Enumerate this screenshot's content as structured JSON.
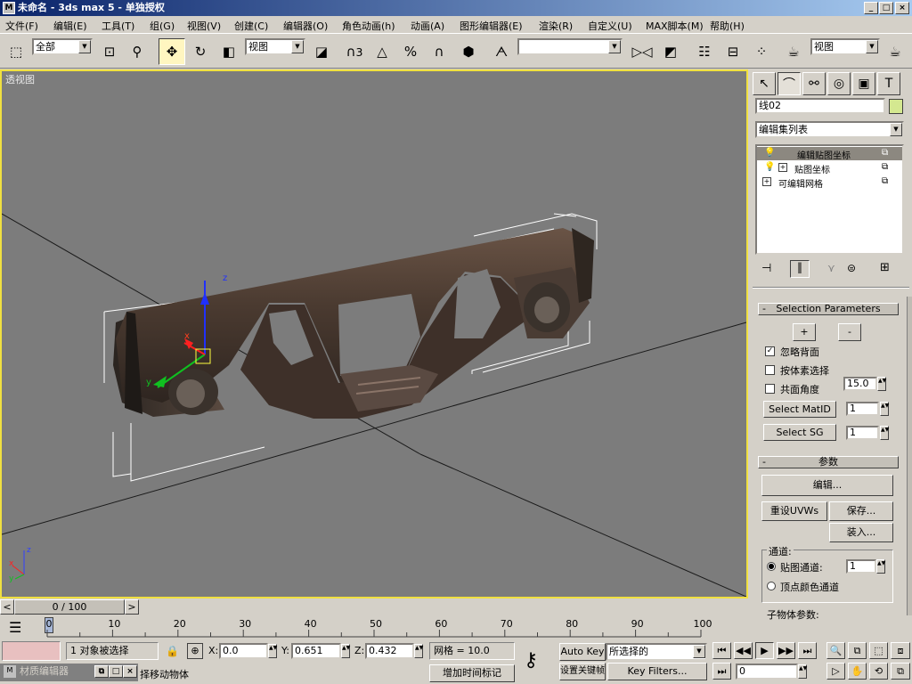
{
  "window": {
    "title": "未命名 - 3ds max 5 - 单独授权",
    "minimize": "_",
    "maximize": "□",
    "close": "×"
  },
  "menu": [
    "文件(F)",
    "编辑(E)",
    "工具(T)",
    "组(G)",
    "视图(V)",
    "创建(C)",
    "编辑器(O)",
    "角色动画(h)",
    "动画(A)",
    "图形编辑器(E)",
    "渲染(R)",
    "自定义(U)",
    "MAX脚本(M)",
    "帮助(H)"
  ],
  "toolbar": {
    "selection_filter": "全部",
    "ref_coord": "视图",
    "named_selection": "",
    "render_type": "视图",
    "snap_label": "3",
    "percent_snap": "%"
  },
  "viewport": {
    "label": "透视图",
    "gizmo_x": "x",
    "gizmo_y": "y",
    "gizmo_z": "z",
    "corner_x": "x",
    "corner_y": "y",
    "corner_z": "z"
  },
  "command_panel": {
    "object_name": "线02",
    "object_color": "#d4e890",
    "modifier_list": "编辑集列表",
    "stack": [
      {
        "label": "编辑贴图坐标",
        "selected": true
      },
      {
        "label": "贴图坐标",
        "selected": false
      },
      {
        "label": "可编辑网格",
        "selected": false
      }
    ],
    "selection_params": {
      "title": "Selection Parameters",
      "plus": "+",
      "minus": "-",
      "ignore_backfaces": "忽略背面",
      "ignore_backfaces_checked": true,
      "select_by_element": "按体素选择",
      "planar_angle": "共面角度",
      "planar_value": "15.0",
      "select_matid": "Select MatID",
      "matid_value": "1",
      "select_sg": "Select SG",
      "sg_value": "1"
    },
    "params": {
      "title": "参数",
      "edit": "编辑...",
      "reset": "重设UVWs",
      "save": "保存...",
      "load": "装入...",
      "channel_group": "通道:",
      "map_channel": "贴图通道:",
      "map_channel_value": "1",
      "vertex_color": "顶点颜色通道",
      "subobject_params": "子物体参数:"
    }
  },
  "timeline": {
    "frame_counter": "0 / 100",
    "prev": "<",
    "next": ">",
    "ticks": [
      "0",
      "10",
      "20",
      "30",
      "40",
      "50",
      "60",
      "70",
      "80",
      "90",
      "100"
    ]
  },
  "status": {
    "material_editor": "材质编辑器",
    "selected_count": "1 对象被选择",
    "x_label": "X:",
    "x_value": "0.0",
    "y_label": "Y:",
    "y_value": "0.651",
    "z_label": "Z:",
    "z_value": "0.432",
    "grid": "网格 = 10.0",
    "prompt": "择移动物体",
    "add_time_tag": "增加时间标记",
    "auto_key": "Auto Key",
    "set_key": "设置关键帧",
    "key_filter_combo": "所选择的",
    "key_filters": "Key Filters...",
    "current_frame": "0"
  }
}
